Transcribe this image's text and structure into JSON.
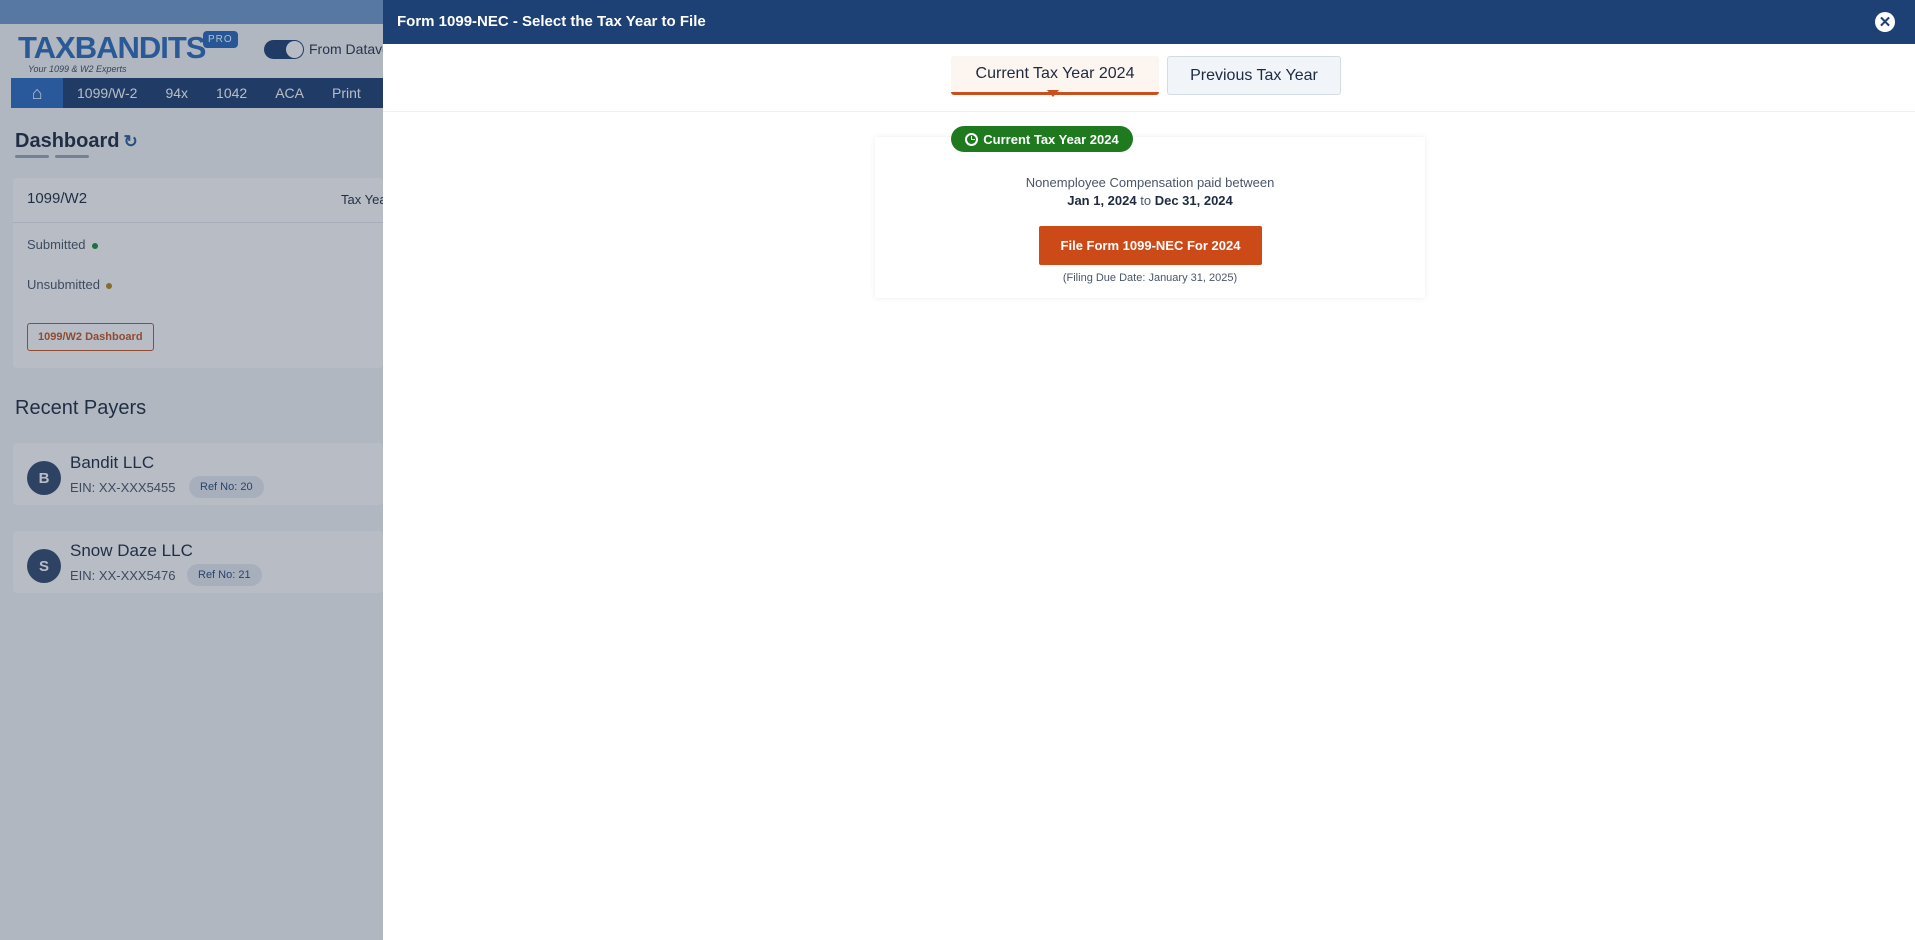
{
  "app": {
    "logo_text": "TAXBANDITS",
    "logo_tagline": "Your 1099 & W2 Experts",
    "pro_badge": "PRO",
    "toggle_label": "From Dataverse"
  },
  "nav": {
    "items": [
      "1099/W-2",
      "94x",
      "1042",
      "ACA",
      "Print"
    ]
  },
  "dashboard": {
    "title": "Dashboard",
    "section": "1099/W2",
    "tax_year_label": "Tax Year",
    "submitted": "Submitted",
    "unsubmitted": "Unsubmitted",
    "button": "1099/W2 Dashboard"
  },
  "recent": {
    "title": "Recent Payers",
    "payers": [
      {
        "initial": "B",
        "name": "Bandit LLC",
        "ein": "EIN: XX-XXX5455",
        "ref": "Ref No: 20"
      },
      {
        "initial": "S",
        "name": "Snow Daze LLC",
        "ein": "EIN: XX-XXX5476",
        "ref": "Ref No: 21"
      }
    ]
  },
  "panel": {
    "title": "Form 1099-NEC - Select the Tax Year to File",
    "tabs": [
      "Current Tax Year 2024",
      "Previous Tax Year"
    ],
    "active_tab": 0,
    "badge": "Current Tax Year 2024",
    "description": "Nonemployee Compensation paid between",
    "start_date": "Jan 1, 2024",
    "to": "to",
    "end_date": "Dec 31, 2024",
    "file_button": "File Form 1099-NEC For 2024",
    "due_note": "(Filing Due Date: January 31, 2025)"
  },
  "colors": {
    "header": "#1d4174",
    "accent": "#cc4a18",
    "badge": "#1f7a1f",
    "submitted": "#1f8a3a",
    "unsubmitted": "#b08a1a"
  }
}
